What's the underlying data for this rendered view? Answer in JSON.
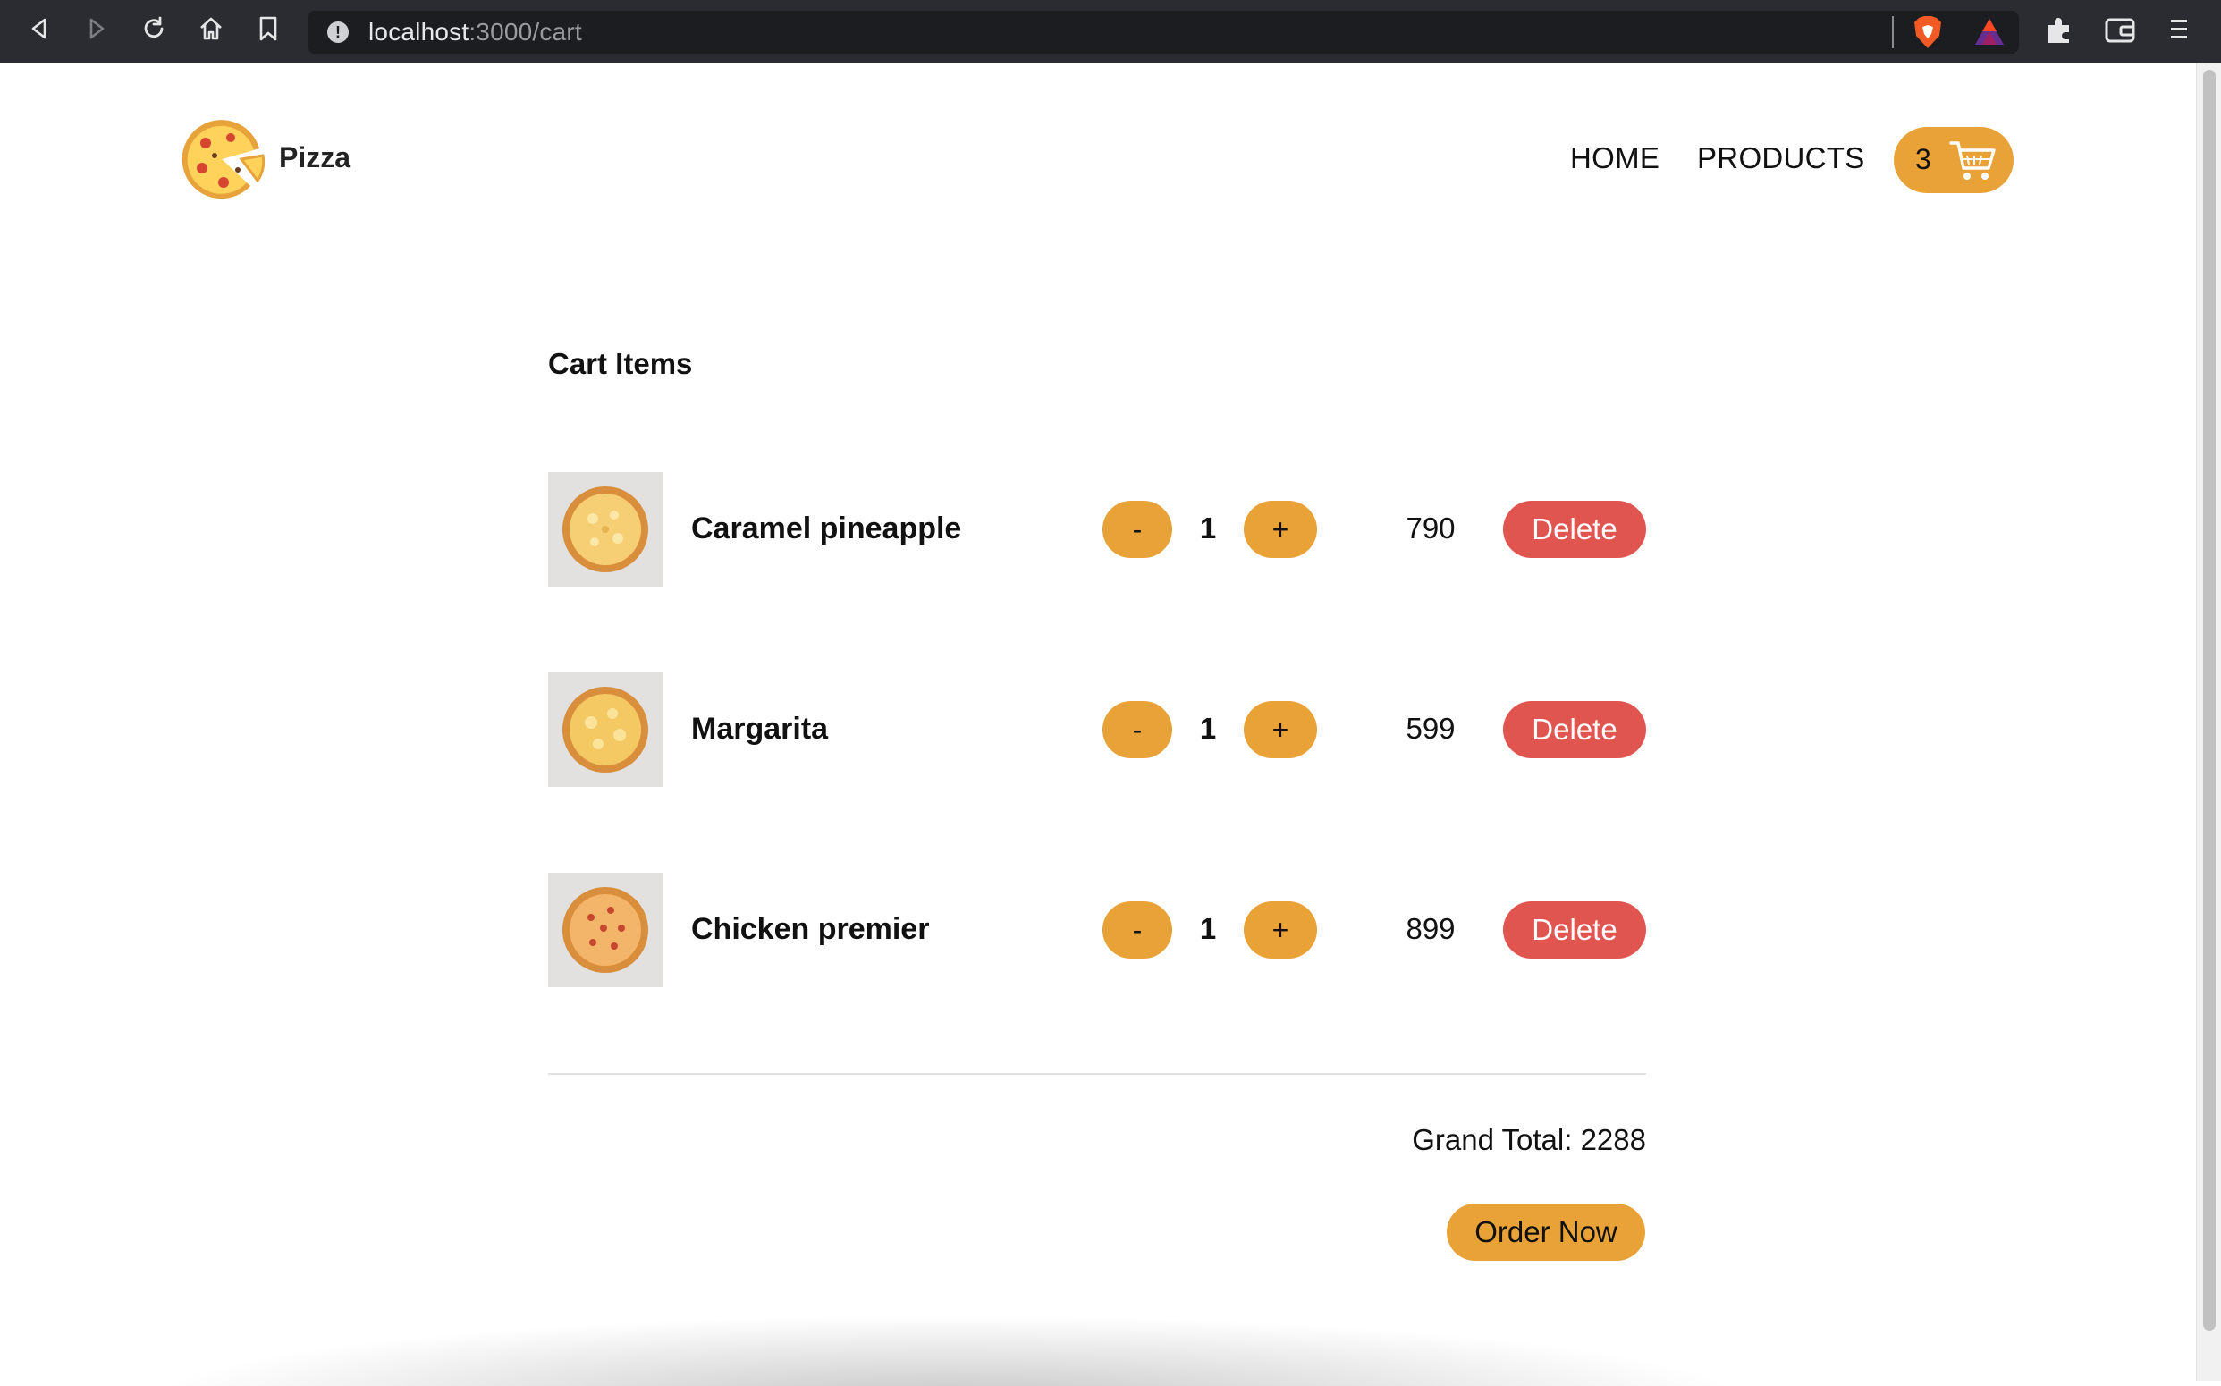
{
  "browser": {
    "url_host": "localhost",
    "url_path": ":3000/cart",
    "icons": [
      "back-icon",
      "forward-icon",
      "reload-icon",
      "home-icon",
      "bookmark-icon",
      "site-info-icon",
      "brave-shields-icon",
      "brave-rewards-icon",
      "extensions-icon",
      "wallet-icon",
      "menu-icon"
    ]
  },
  "header": {
    "brand": "Pizza",
    "nav": {
      "home": "HOME",
      "products": "PRODUCTS"
    },
    "cart_count": "3"
  },
  "cart": {
    "title": "Cart Items",
    "items": [
      {
        "name": "Caramel pineapple",
        "qty": "1",
        "price": "790",
        "minus": "-",
        "plus": "+",
        "delete": "Delete"
      },
      {
        "name": "Margarita",
        "qty": "1",
        "price": "599",
        "minus": "-",
        "plus": "+",
        "delete": "Delete"
      },
      {
        "name": "Chicken premier",
        "qty": "1",
        "price": "899",
        "minus": "-",
        "plus": "+",
        "delete": "Delete"
      }
    ],
    "grand_total": "Grand Total: 2288",
    "order_button": "Order Now"
  },
  "colors": {
    "accent": "#e9a237",
    "delete": "#e05550",
    "chrome_bg": "#2b2c31"
  }
}
